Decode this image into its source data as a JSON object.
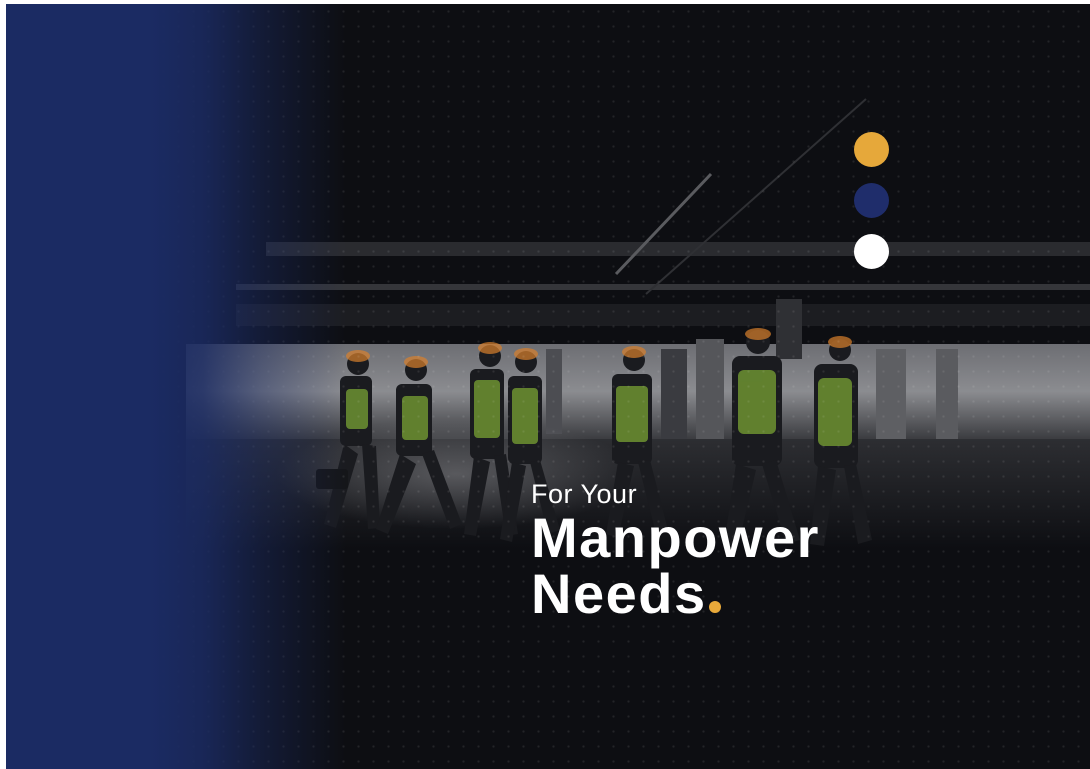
{
  "headline": {
    "line1": "For Your",
    "line2": "Manpower",
    "line3": "Needs"
  },
  "colors": {
    "background": "#0d0e12",
    "brand_blue": "#1b2b63",
    "accent_gold": "#e8a93a",
    "dot_gold": "#e6a83a",
    "dot_blue": "#1f2d6b",
    "dot_white": "#ffffff",
    "safety_vest": "#9bd43c",
    "helmet": "#d9802c"
  },
  "decor": {
    "dots": [
      "gold",
      "blue",
      "white"
    ],
    "photo": "workers-walking-construction-site"
  }
}
